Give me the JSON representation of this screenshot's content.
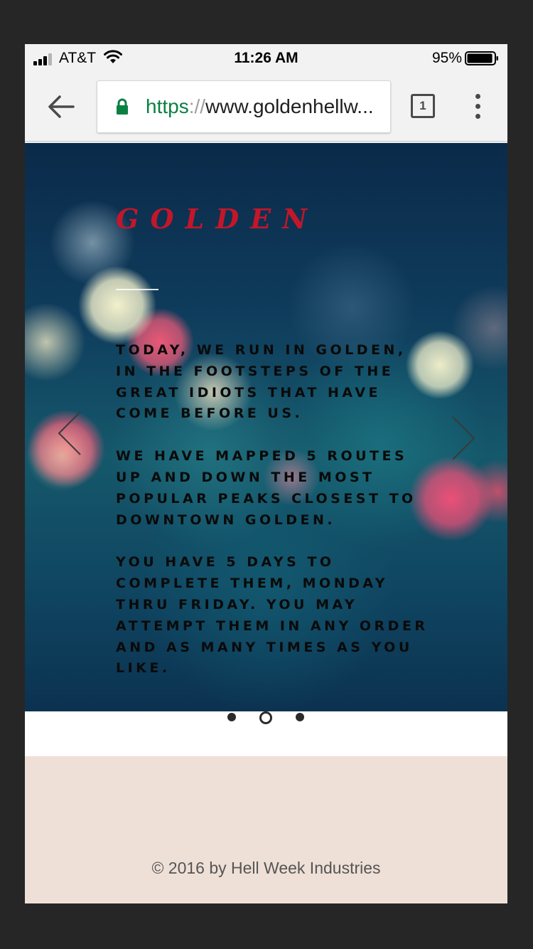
{
  "status_bar": {
    "carrier": "AT&T",
    "time": "11:26 AM",
    "battery_percent": "95%",
    "battery_level": 0.95
  },
  "browser": {
    "url_scheme": "https",
    "url_separator": "://",
    "url_host": "www.goldenhellw...",
    "tab_count": "1"
  },
  "hero": {
    "title": "GOLDEN",
    "paragraphs": [
      "TODAY, WE RUN IN GOLDEN, IN THE FOOTSTEPS OF THE GREAT IDIOTS THAT HAVE COME BEFORE US.",
      "WE HAVE MAPPED 5 ROUTES UP AND DOWN THE MOST POPULAR PEAKS CLOSEST TO DOWNTOWN GOLDEN.",
      "YOU HAVE 5 DAYS TO COMPLETE THEM, MONDAY THRU FRIDAY. YOU MAY ATTEMPT THEM IN ANY ORDER AND AS MANY TIMES AS YOU LIKE."
    ],
    "title_color": "#c3162a"
  },
  "slider": {
    "slide_count": 3,
    "active_index": 1
  },
  "footer": {
    "copyright": "© 2016 by Hell Week Industries",
    "background": "#efe0d7"
  },
  "icons": {
    "back": "arrow-left-icon",
    "lock": "lock-icon",
    "menu": "more-vert-icon",
    "prev": "chevron-left-icon",
    "next": "chevron-right-icon"
  }
}
